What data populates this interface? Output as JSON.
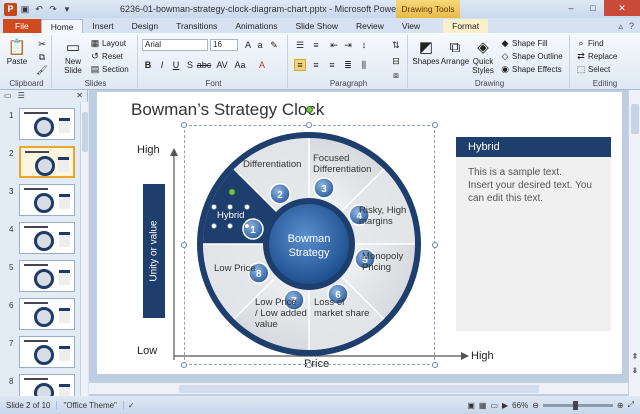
{
  "window": {
    "title": "6236-01-bowman-strategy-clock-diagram-chart.pptx - Microsoft PowerPoint",
    "app_letter": "P",
    "context_tab": "Drawing Tools",
    "minimize": "–",
    "maximize": "□",
    "close": "✕"
  },
  "tabs": [
    "File",
    "Home",
    "Insert",
    "Design",
    "Transitions",
    "Animations",
    "Slide Show",
    "Review",
    "View",
    "Format"
  ],
  "ribbon": {
    "clipboard": {
      "label": "Clipboard",
      "paste": "Paste"
    },
    "slides": {
      "label": "Slides",
      "new_slide": "New Slide",
      "layout": "Layout",
      "reset": "Reset",
      "section": "Section"
    },
    "font": {
      "label": "Font",
      "font_name": "Arial",
      "font_size": "16"
    },
    "paragraph": {
      "label": "Paragraph"
    },
    "drawing": {
      "label": "Drawing",
      "shapes": "Shapes",
      "arrange": "Arrange",
      "quick_styles": "Quick Styles",
      "shape_fill": "Shape Fill",
      "shape_outline": "Shape Outline",
      "shape_effects": "Shape Effects"
    },
    "editing": {
      "label": "Editing",
      "find": "Find",
      "replace": "Replace",
      "select": "Select"
    }
  },
  "slides_panel": {
    "tabs": [
      "Slides",
      "Outline"
    ],
    "slide_numbers": [
      "1",
      "2",
      "3",
      "4",
      "5",
      "6",
      "7",
      "8"
    ],
    "selected_index": 2
  },
  "slide": {
    "title": "Bowman’s Strategy Clock",
    "axis": {
      "high_y": "High",
      "low": "Low",
      "high_x": "High",
      "x_label": "Price",
      "y_label": "Unity or value"
    },
    "center_text": [
      "Bowman",
      "Strategy"
    ],
    "segments": {
      "hybrid": "Hybrid",
      "differentiation": "Differentiation",
      "focused_differentiation": [
        "Focused",
        "Differentiation"
      ],
      "risky_high_margins": [
        "Risky, High",
        "margins"
      ],
      "monopoly_pricing": [
        "Monopoly",
        "Pricing"
      ],
      "loss_of_market_share": [
        "Loss of",
        "market share"
      ],
      "low_price_low_added_value": [
        "Low Price",
        "/ Low added",
        "value"
      ],
      "low_price": "Low Price"
    },
    "numbers": [
      "1",
      "2",
      "3",
      "4",
      "5",
      "6",
      "7",
      "8"
    ],
    "info_box": {
      "heading": "Hybrid",
      "body": [
        "This is a sample text.",
        "Insert your desired text. You",
        "can edit this text."
      ]
    }
  },
  "status": {
    "slide_info": "Slide 2 of 10",
    "theme": "\"Office Theme\"",
    "zoom": "66%"
  },
  "colors": {
    "navy": "#1e3f6d",
    "accent_blue": "#2f5f9e",
    "file_tab": "#d04a20"
  }
}
